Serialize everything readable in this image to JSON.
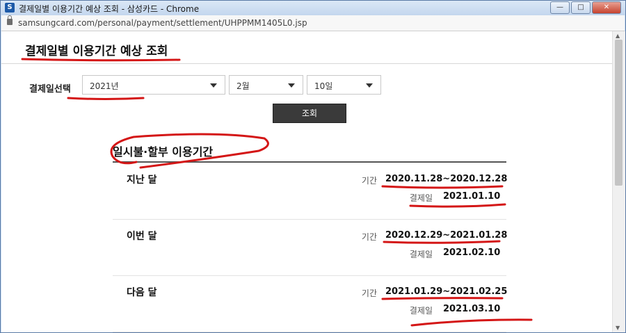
{
  "window": {
    "title": "결제일별 이용기간 예상 조회 - 삼성카드 - Chrome",
    "favicon": "S",
    "controls": [
      "minimize-icon",
      "maximize-icon",
      "close-icon"
    ]
  },
  "address": {
    "url": "samsungcard.com/personal/payment/settlement/UHPPMM1405L0.jsp"
  },
  "page": {
    "title": "결제일별 이용기간 예상 조회",
    "select_label": "결제일선택",
    "year": "2021년",
    "month": "2월",
    "day": "10일",
    "search_button": "조회"
  },
  "section": {
    "title": "일시불·할부 이용기간",
    "period_label": "기간",
    "payday_label": "결제일",
    "rows": [
      {
        "name": "지난 달",
        "period": "2020.11.28~2020.12.28",
        "payday": "2021.01.10"
      },
      {
        "name": "이번 달",
        "period": "2020.12.29~2021.01.28",
        "payday": "2021.02.10"
      },
      {
        "name": "다음 달",
        "period": "2021.01.29~2021.02.25",
        "payday": "2021.03.10"
      }
    ]
  },
  "colors": {
    "annotation": "#d41616",
    "button": "#3a3a3a",
    "title_bar": "#c9dcf1"
  }
}
